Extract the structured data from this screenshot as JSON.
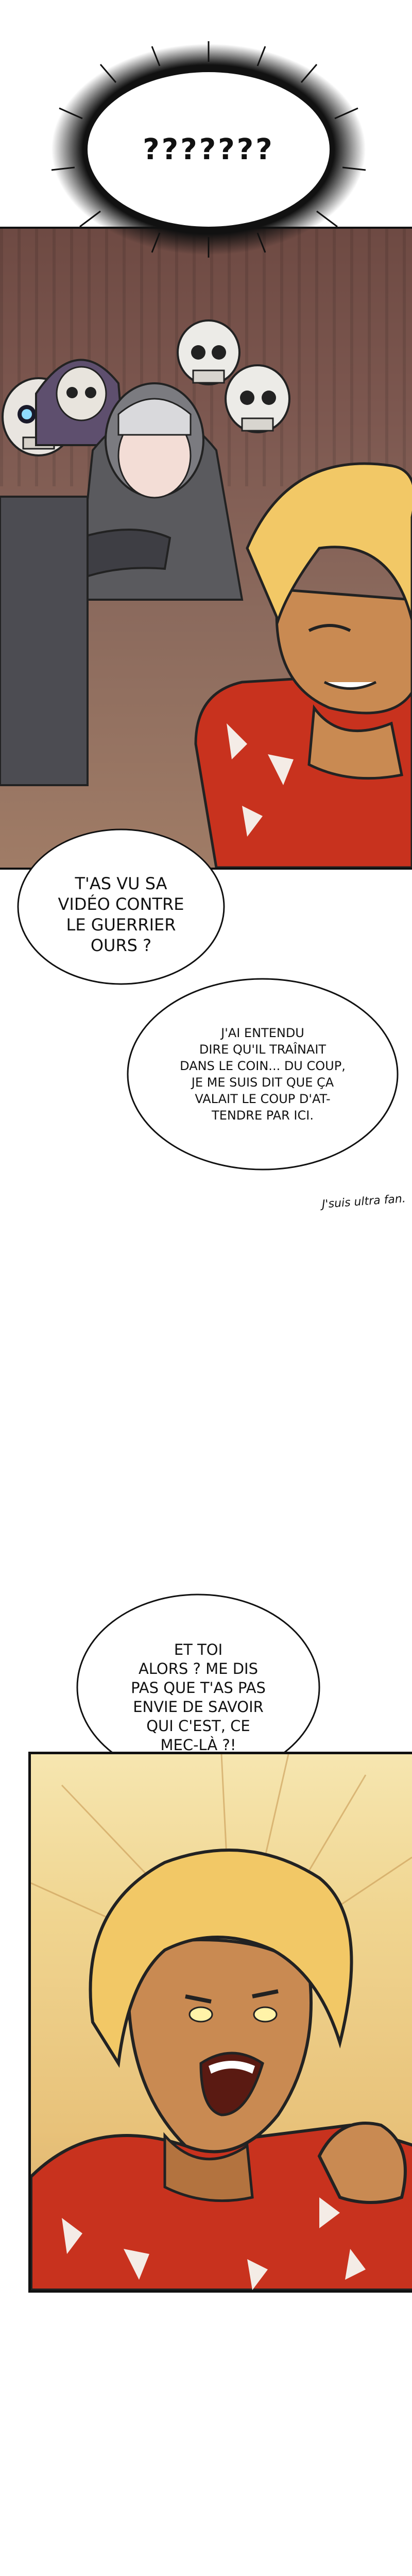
{
  "thought_bubble": {
    "text": "???????"
  },
  "speech_bubbles": [
    {
      "id": "seen-video",
      "text": "T'AS VU SA\nVIDÉO CONTRE\nLE GUERRIER\nOURS ?"
    },
    {
      "id": "heard-training",
      "text": "J'AI ENTENDU\nDIRE QU'IL TRAÎNAIT\nDANS LE COIN... DU COUP,\nJE ME SUIS DIT QUE ÇA\nVALAIT LE COUP D'AT-\nTENDRE PAR ICI."
    },
    {
      "id": "and-you",
      "text": "ET TOI\nALORS ? ME DIS\nPAS QUE T'AS PAS\nENVIE DE SAVOIR\nQUI C'EST, CE\nMEC-LÀ ?!"
    }
  ],
  "side_note": {
    "text": "J'suis ultra fan."
  },
  "colors": {
    "shirt_red": "#c8321e",
    "hair_blond": "#f2c866",
    "skin_tan": "#c98a52",
    "background_warm": "#f0d590",
    "wall_brown": "#7d5850"
  }
}
